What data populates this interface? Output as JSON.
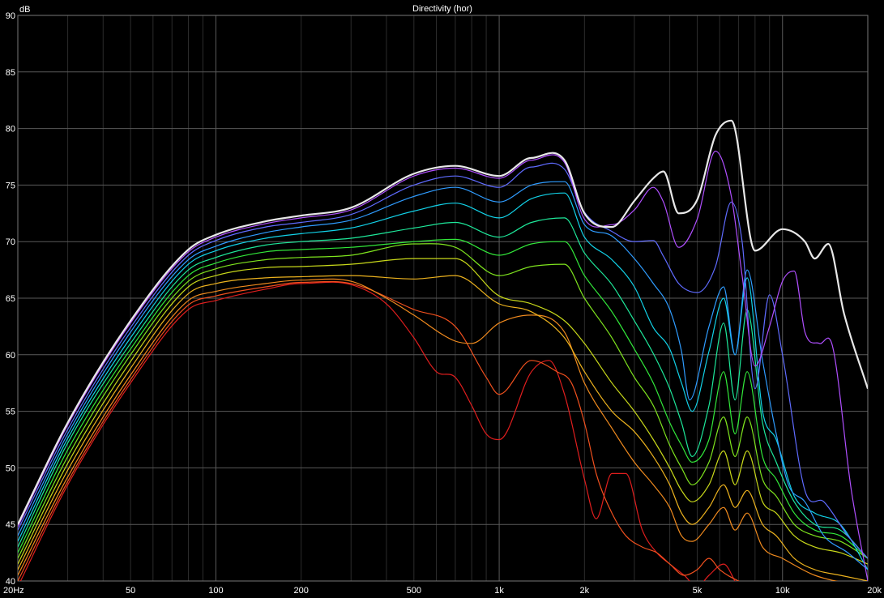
{
  "chart_data": {
    "type": "line",
    "title": "Directivity (hor)",
    "ylabel": "dB",
    "xlabel": "",
    "xscale": "log",
    "xlim": [
      20,
      20000
    ],
    "ylim": [
      40,
      90
    ],
    "grid": true,
    "background": "#000000",
    "grid_color": "#5a5a5a",
    "minor_grid_color": "#2c2c2c",
    "text_color": "#ffffff",
    "x_ticks": [
      {
        "value": 20,
        "label": "20Hz"
      },
      {
        "value": 50,
        "label": "50"
      },
      {
        "value": 100,
        "label": "100"
      },
      {
        "value": 200,
        "label": "200"
      },
      {
        "value": 500,
        "label": "500"
      },
      {
        "value": 1000,
        "label": "1k"
      },
      {
        "value": 2000,
        "label": "2k"
      },
      {
        "value": 5000,
        "label": "5k"
      },
      {
        "value": 10000,
        "label": "10k"
      },
      {
        "value": 20000,
        "label": "20k"
      }
    ],
    "y_ticks": [
      {
        "value": 40,
        "label": "40"
      },
      {
        "value": 45,
        "label": "45"
      },
      {
        "value": 50,
        "label": "50"
      },
      {
        "value": 55,
        "label": "55"
      },
      {
        "value": 60,
        "label": "60"
      },
      {
        "value": 65,
        "label": "65"
      },
      {
        "value": 70,
        "label": "70"
      },
      {
        "value": 75,
        "label": "75"
      },
      {
        "value": 80,
        "label": "80"
      },
      {
        "value": 85,
        "label": "85"
      },
      {
        "value": 90,
        "label": "90"
      }
    ],
    "series": [
      {
        "color": "#e8e8e8",
        "width": 2.2,
        "x": [
          20,
          30,
          50,
          80,
          100,
          150,
          200,
          300,
          500,
          700,
          1000,
          1300,
          1700,
          2000,
          2500,
          3000,
          3500,
          3800,
          4300,
          5000,
          5800,
          6600,
          8000,
          10000,
          12000,
          13000,
          14500,
          16500,
          20000
        ],
        "y": [
          45,
          54,
          63,
          69.3,
          70.6,
          71.8,
          72.3,
          73,
          76,
          76.7,
          75.8,
          77.4,
          77.2,
          72.5,
          71.3,
          73.6,
          75.6,
          76.2,
          72.5,
          73.7,
          79.4,
          80.7,
          69.2,
          71.1,
          70,
          68.5,
          69.8,
          63.6,
          57
        ]
      },
      {
        "color": "#b04fff",
        "width": 1.2,
        "x": [
          20,
          30,
          50,
          80,
          100,
          150,
          200,
          300,
          500,
          700,
          1000,
          1300,
          1700,
          2000,
          2500,
          3000,
          3500,
          3800,
          4300,
          5000,
          5800,
          6600,
          7200,
          8000,
          9000,
          10000,
          11000,
          12000,
          13500,
          15000,
          17500,
          20000
        ],
        "y": [
          44.8,
          53.8,
          62.8,
          69.1,
          70.4,
          71.6,
          72.1,
          72.8,
          75.8,
          76.5,
          75.6,
          77.2,
          77,
          72,
          71.5,
          72.8,
          74.8,
          73.5,
          69.5,
          72,
          78,
          74,
          67,
          59,
          62.5,
          66.5,
          67.4,
          62,
          61,
          60.8,
          48,
          40
        ]
      },
      {
        "color": "#5f6bff",
        "width": 1.2,
        "x": [
          20,
          30,
          50,
          80,
          100,
          150,
          200,
          300,
          500,
          700,
          1000,
          1300,
          1700,
          2000,
          2500,
          3000,
          3500,
          3800,
          4300,
          5000,
          5800,
          6600,
          7200,
          8000,
          9000,
          10000,
          12000,
          14000,
          17000,
          20000
        ],
        "y": [
          44.5,
          53.4,
          62.4,
          68.8,
          70.1,
          71.3,
          71.7,
          72.4,
          75,
          75.8,
          74.8,
          76.6,
          76.4,
          72.6,
          70.9,
          70,
          70.1,
          68.7,
          66.3,
          65.5,
          67.8,
          73.5,
          70,
          57,
          65.3,
          60,
          48,
          47,
          44,
          42
        ]
      },
      {
        "color": "#2f9cff",
        "width": 1.2,
        "x": [
          20,
          30,
          50,
          80,
          100,
          150,
          200,
          300,
          500,
          700,
          1000,
          1300,
          1700,
          2000,
          2500,
          3000,
          3500,
          4000,
          4400,
          4700,
          5500,
          6200,
          6800,
          7500,
          8500,
          9500,
          10500,
          12000,
          14000,
          17000,
          20000
        ],
        "y": [
          44,
          53,
          62,
          68.4,
          69.6,
          70.8,
          71.3,
          71.9,
          74,
          74.8,
          73.5,
          75,
          75.3,
          71.5,
          70.5,
          68.5,
          66.3,
          64,
          60.3,
          56,
          62.5,
          66,
          60,
          67.5,
          59.5,
          53,
          48.5,
          47,
          44,
          42.5,
          41
        ]
      },
      {
        "color": "#12d2e8",
        "width": 1.2,
        "x": [
          20,
          30,
          50,
          80,
          100,
          150,
          200,
          300,
          500,
          700,
          1000,
          1300,
          1700,
          2000,
          2500,
          3000,
          3500,
          4000,
          4400,
          4800,
          5500,
          6200,
          6800,
          7500,
          8500,
          9500,
          11000,
          13000,
          16000,
          20000
        ],
        "y": [
          43.5,
          52.6,
          61.5,
          68,
          69.2,
          70.3,
          70.7,
          71.2,
          72.7,
          73.4,
          72.1,
          73.8,
          74.3,
          70.4,
          68.4,
          66,
          62.4,
          60.5,
          57.5,
          55,
          60.3,
          65,
          60,
          66.8,
          55,
          52.5,
          47.5,
          46,
          45,
          41
        ]
      },
      {
        "color": "#1ee89a",
        "width": 1.2,
        "x": [
          20,
          30,
          50,
          80,
          100,
          150,
          200,
          300,
          500,
          700,
          1000,
          1300,
          1700,
          2000,
          2500,
          3000,
          3500,
          4000,
          4400,
          4800,
          5500,
          6200,
          6800,
          7500,
          8500,
          9500,
          11000,
          13000,
          16000,
          20000
        ],
        "y": [
          43,
          52.2,
          61,
          67.5,
          68.6,
          69.7,
          70,
          70.3,
          71.2,
          71.7,
          70.4,
          71.7,
          72.1,
          69,
          66.2,
          63,
          60.1,
          57,
          54,
          51,
          55.5,
          62.8,
          56,
          64,
          54,
          50.5,
          47,
          45,
          44.5,
          42
        ]
      },
      {
        "color": "#32e83a",
        "width": 1.2,
        "x": [
          20,
          30,
          50,
          80,
          100,
          150,
          200,
          300,
          500,
          700,
          1000,
          1300,
          1700,
          2000,
          2500,
          3000,
          3500,
          4000,
          4400,
          4800,
          5500,
          6200,
          6800,
          7500,
          8500,
          9500,
          11000,
          13000,
          16000,
          20000
        ],
        "y": [
          42.5,
          51.6,
          60.5,
          67,
          68.1,
          69.1,
          69.3,
          69.5,
          70,
          70.2,
          68.8,
          69.8,
          70,
          67,
          63.8,
          60.5,
          57.5,
          54,
          52,
          50.5,
          52.5,
          58.5,
          53,
          58.5,
          51,
          49,
          46,
          44.5,
          44,
          42
        ]
      },
      {
        "color": "#7fe41e",
        "width": 1.2,
        "x": [
          20,
          30,
          50,
          80,
          100,
          150,
          200,
          300,
          500,
          700,
          1000,
          1300,
          1700,
          2000,
          2500,
          3000,
          3500,
          4000,
          4400,
          4800,
          5500,
          6200,
          6800,
          7500,
          8500,
          9500,
          11000,
          13000,
          16000,
          20000
        ],
        "y": [
          42,
          51,
          60,
          66.5,
          67.6,
          68.4,
          68.6,
          68.8,
          69.8,
          69.5,
          67,
          67.8,
          68,
          65,
          61.5,
          58,
          55.5,
          52,
          50,
          48.5,
          50.5,
          54.5,
          51,
          54.5,
          49,
          47.5,
          45,
          44,
          43.5,
          42
        ]
      },
      {
        "color": "#c8d81a",
        "width": 1.2,
        "x": [
          20,
          30,
          50,
          80,
          100,
          150,
          200,
          300,
          500,
          700,
          1000,
          1300,
          1700,
          2000,
          2500,
          3000,
          3500,
          4000,
          4400,
          4800,
          5500,
          6200,
          6800,
          7500,
          8500,
          9500,
          11000,
          13000,
          16000,
          20000
        ],
        "y": [
          41.5,
          50.4,
          59.4,
          66,
          67,
          67.7,
          67.8,
          68,
          68.5,
          68.5,
          65.2,
          64.5,
          63,
          61,
          57.5,
          55,
          52.5,
          50,
          48,
          47,
          48.5,
          51.5,
          48.5,
          51.5,
          47,
          46,
          44,
          43,
          42.5,
          41.5
        ]
      },
      {
        "color": "#ecb21e",
        "width": 1.2,
        "x": [
          20,
          30,
          50,
          80,
          100,
          150,
          200,
          300,
          500,
          700,
          1000,
          1300,
          1700,
          2000,
          2500,
          3000,
          3500,
          4000,
          4400,
          4800,
          5500,
          6200,
          6800,
          7500,
          8500,
          9500,
          11000,
          13000,
          16000,
          20000
        ],
        "y": [
          41,
          49.8,
          58.8,
          65.4,
          66.3,
          66.8,
          66.9,
          67,
          66.7,
          67,
          64.5,
          63.8,
          61.5,
          58.5,
          55,
          53.2,
          51,
          48.5,
          46,
          45,
          46.5,
          48.5,
          46.5,
          48,
          45,
          44,
          42,
          41,
          40.5,
          40
        ]
      },
      {
        "color": "#f08a1e",
        "width": 1.2,
        "x": [
          20,
          30,
          50,
          80,
          100,
          150,
          200,
          300,
          400,
          500,
          700,
          800,
          1000,
          1300,
          1700,
          2000,
          2500,
          3000,
          3500,
          4000,
          4400,
          4800,
          5500,
          6200,
          6800,
          7500,
          8500,
          10000,
          13000,
          20000
        ],
        "y": [
          40.5,
          49.2,
          58.2,
          64.8,
          65.6,
          66.3,
          66.6,
          66.5,
          65,
          63.5,
          61.2,
          61,
          62.8,
          63.5,
          62,
          57.5,
          53.5,
          50.5,
          48.5,
          46.5,
          44,
          43.5,
          45,
          46.5,
          44.5,
          46,
          43,
          42,
          40.5,
          39.5
        ]
      },
      {
        "color": "#f0501e",
        "width": 1.2,
        "x": [
          20,
          30,
          50,
          80,
          100,
          150,
          200,
          300,
          500,
          700,
          900,
          1000,
          1300,
          1600,
          1800,
          2000,
          2200,
          2500,
          2800,
          3200,
          3600,
          4000,
          4500,
          5000,
          5500,
          6000,
          7000,
          8000,
          10000,
          20000
        ],
        "y": [
          40,
          48.8,
          57.8,
          64.4,
          65.2,
          66,
          66.4,
          66.3,
          64,
          62.5,
          58,
          56.5,
          59.5,
          58.5,
          57.5,
          54,
          49.5,
          46,
          44,
          43,
          42.5,
          41.5,
          40.5,
          41,
          42,
          41,
          40,
          39.5,
          39,
          38
        ]
      },
      {
        "color": "#e01e1e",
        "width": 1.2,
        "x": [
          20,
          30,
          50,
          80,
          100,
          150,
          200,
          300,
          400,
          500,
          600,
          700,
          800,
          900,
          1000,
          1300,
          1500,
          1700,
          2000,
          2200,
          2500,
          2800,
          3200,
          3600,
          4000,
          4500,
          5000,
          5500,
          6200,
          7000,
          8000,
          10000,
          20000
        ],
        "y": [
          39.5,
          48.5,
          57.5,
          64,
          64.8,
          65.8,
          66.3,
          66.2,
          64.5,
          61.5,
          58.5,
          58,
          55.5,
          53,
          52.5,
          58.5,
          59.5,
          56.5,
          49,
          45.5,
          49.5,
          49.5,
          44.5,
          42.5,
          41.5,
          40.5,
          39.5,
          40.5,
          41.5,
          39.5,
          39,
          38.5,
          37.5
        ]
      }
    ]
  }
}
